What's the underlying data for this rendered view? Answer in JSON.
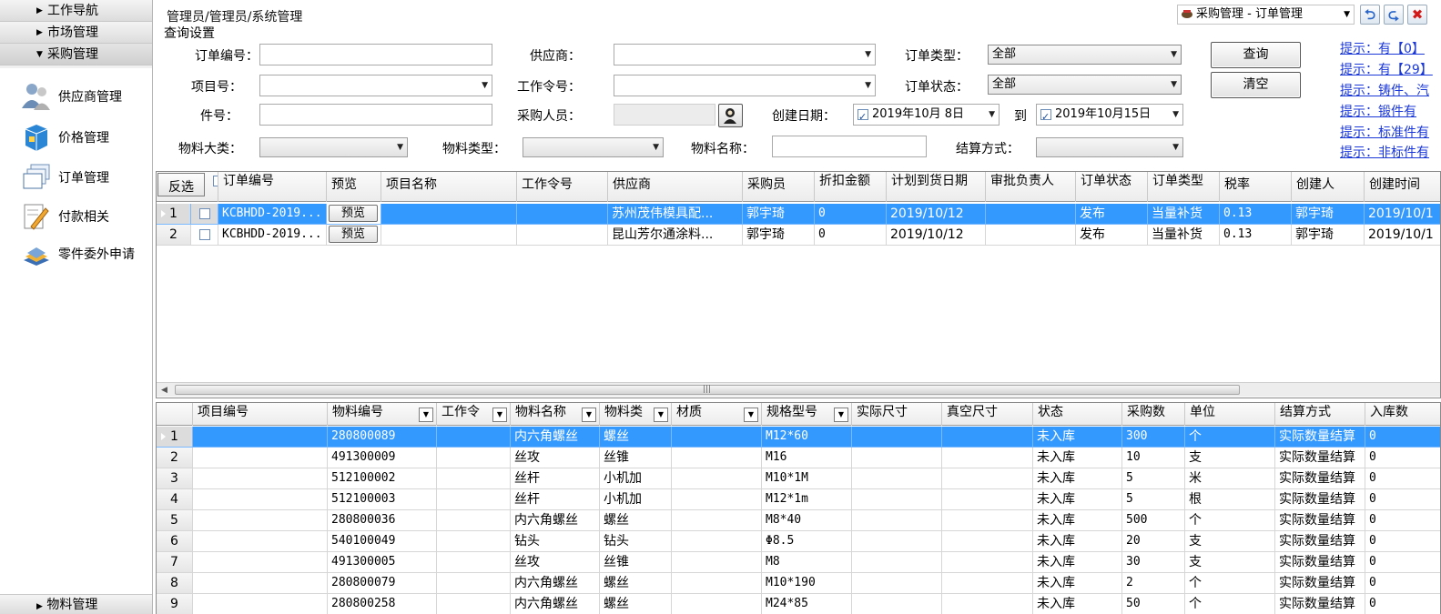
{
  "nav": {
    "sections": [
      {
        "label": "工作导航",
        "arrow": "▶"
      },
      {
        "label": "市场管理",
        "arrow": "▶"
      },
      {
        "label": "采购管理",
        "arrow": "▼"
      }
    ],
    "items": [
      {
        "label": "供应商管理",
        "icon": "users-icon"
      },
      {
        "label": "价格管理",
        "icon": "price-box-icon"
      },
      {
        "label": "订单管理",
        "icon": "order-windows-icon"
      },
      {
        "label": "付款相关",
        "icon": "payment-pen-icon"
      },
      {
        "label": "零件委外申请",
        "icon": "outsource-books-icon"
      }
    ],
    "bottom": {
      "label": "物料管理",
      "arrow": "▶"
    }
  },
  "header": {
    "breadcrumb": "管理员/管理员/系统管理",
    "query_title": "查询设置",
    "module_select": "采购管理 - 订单管理",
    "back_icon": "back-arrow-icon",
    "forward_icon": "forward-arrow-icon",
    "close_icon": "close-icon"
  },
  "form": {
    "order_no_label": "订单编号：",
    "order_no_value": "",
    "supplier_label": "供应商：",
    "supplier_value": "",
    "order_type_label": "订单类型：",
    "order_type_value": "全部",
    "project_no_label": "项目号：",
    "project_no_value": "",
    "work_order_label": "工作令号：",
    "work_order_value": "",
    "order_status_label": "订单状态：",
    "order_status_value": "全部",
    "part_no_label": "件号：",
    "part_no_value": "",
    "buyer_label": "采购人员：",
    "buyer_value": "",
    "create_date_label": "创建日期：",
    "date_from": "2019年10月 8日",
    "date_to_label": "到",
    "date_to": "2019年10月15日",
    "material_major_label": "物料大类：",
    "material_major_value": "",
    "material_type_label": "物料类型：",
    "material_type_value": "",
    "material_name_label": "物料名称：",
    "material_name_value": "",
    "settle_label": "结算方式：",
    "settle_value": "",
    "query_button": "查询",
    "clear_button": "清空"
  },
  "tips": [
    "提示：有【0】",
    "提示：有【29】",
    "提示：铸件、汽",
    "提示：锻件有",
    "提示：标准件有",
    "提示：非标件有"
  ],
  "orders": {
    "invert_label": "反选",
    "columns": [
      "订单编号",
      "预览",
      "项目名称",
      "工作令号",
      "供应商",
      "采购员",
      "折扣金额",
      "计划到货日期",
      "审批负责人",
      "订单状态",
      "订单类型",
      "税率",
      "创建人",
      "创建时间"
    ],
    "preview_label": "预览",
    "rows": [
      {
        "idx": "1",
        "order_no": "KCBHDD-2019...",
        "project": "",
        "work_order": "",
        "supplier": "苏州茂伟模具配...",
        "buyer": "郭宇琦",
        "discount": "0",
        "plan_date": "2019/10/12",
        "approver": "",
        "status": "发布",
        "type": "当量补货",
        "tax": "0.13",
        "creator": "郭宇琦",
        "created": "2019/10/1"
      },
      {
        "idx": "2",
        "order_no": "KCBHDD-2019...",
        "project": "",
        "work_order": "",
        "supplier": "昆山芳尔通涂料...",
        "buyer": "郭宇琦",
        "discount": "0",
        "plan_date": "2019/10/12",
        "approver": "",
        "status": "发布",
        "type": "当量补货",
        "tax": "0.13",
        "creator": "郭宇琦",
        "created": "2019/10/1"
      }
    ]
  },
  "details": {
    "columns": [
      "项目编号",
      "物料编号",
      "工作令",
      "物料名称",
      "物料类",
      "材质",
      "规格型号",
      "实际尺寸",
      "真空尺寸",
      "状态",
      "采购数",
      "单位",
      "结算方式",
      "入库数"
    ],
    "rows": [
      {
        "idx": "1",
        "project": "",
        "mat_no": "280800089",
        "work_order": "",
        "name": "内六角螺丝",
        "cat": "螺丝",
        "material": "",
        "spec": "M12*60",
        "actual": "",
        "vacuum": "",
        "status": "未入库",
        "qty": "300",
        "unit": "个",
        "settle": "实际数量结算",
        "in": "0"
      },
      {
        "idx": "2",
        "project": "",
        "mat_no": "491300009",
        "work_order": "",
        "name": "丝攻",
        "cat": "丝锥",
        "material": "",
        "spec": "M16",
        "actual": "",
        "vacuum": "",
        "status": "未入库",
        "qty": "10",
        "unit": "支",
        "settle": "实际数量结算",
        "in": "0"
      },
      {
        "idx": "3",
        "project": "",
        "mat_no": "512100002",
        "work_order": "",
        "name": "丝杆",
        "cat": "小机加",
        "material": "",
        "spec": "M10*1M",
        "actual": "",
        "vacuum": "",
        "status": "未入库",
        "qty": "5",
        "unit": "米",
        "settle": "实际数量结算",
        "in": "0"
      },
      {
        "idx": "4",
        "project": "",
        "mat_no": "512100003",
        "work_order": "",
        "name": "丝杆",
        "cat": "小机加",
        "material": "",
        "spec": "M12*1m",
        "actual": "",
        "vacuum": "",
        "status": "未入库",
        "qty": "5",
        "unit": "根",
        "settle": "实际数量结算",
        "in": "0"
      },
      {
        "idx": "5",
        "project": "",
        "mat_no": "280800036",
        "work_order": "",
        "name": "内六角螺丝",
        "cat": "螺丝",
        "material": "",
        "spec": "M8*40",
        "actual": "",
        "vacuum": "",
        "status": "未入库",
        "qty": "500",
        "unit": "个",
        "settle": "实际数量结算",
        "in": "0"
      },
      {
        "idx": "6",
        "project": "",
        "mat_no": "540100049",
        "work_order": "",
        "name": "钻头",
        "cat": "钻头",
        "material": "",
        "spec": "Φ8.5",
        "actual": "",
        "vacuum": "",
        "status": "未入库",
        "qty": "20",
        "unit": "支",
        "settle": "实际数量结算",
        "in": "0"
      },
      {
        "idx": "7",
        "project": "",
        "mat_no": "491300005",
        "work_order": "",
        "name": "丝攻",
        "cat": "丝锥",
        "material": "",
        "spec": "M8",
        "actual": "",
        "vacuum": "",
        "status": "未入库",
        "qty": "30",
        "unit": "支",
        "settle": "实际数量结算",
        "in": "0"
      },
      {
        "idx": "8",
        "project": "",
        "mat_no": "280800079",
        "work_order": "",
        "name": "内六角螺丝",
        "cat": "螺丝",
        "material": "",
        "spec": "M10*190",
        "actual": "",
        "vacuum": "",
        "status": "未入库",
        "qty": "2",
        "unit": "个",
        "settle": "实际数量结算",
        "in": "0"
      },
      {
        "idx": "9",
        "project": "",
        "mat_no": "280800258",
        "work_order": "",
        "name": "内六角螺丝",
        "cat": "螺丝",
        "material": "",
        "spec": "M24*85",
        "actual": "",
        "vacuum": "",
        "status": "未入库",
        "qty": "50",
        "unit": "个",
        "settle": "实际数量结算",
        "in": "0"
      }
    ]
  },
  "colors": {
    "selection": "#3399ff",
    "link": "#1a37d8"
  }
}
